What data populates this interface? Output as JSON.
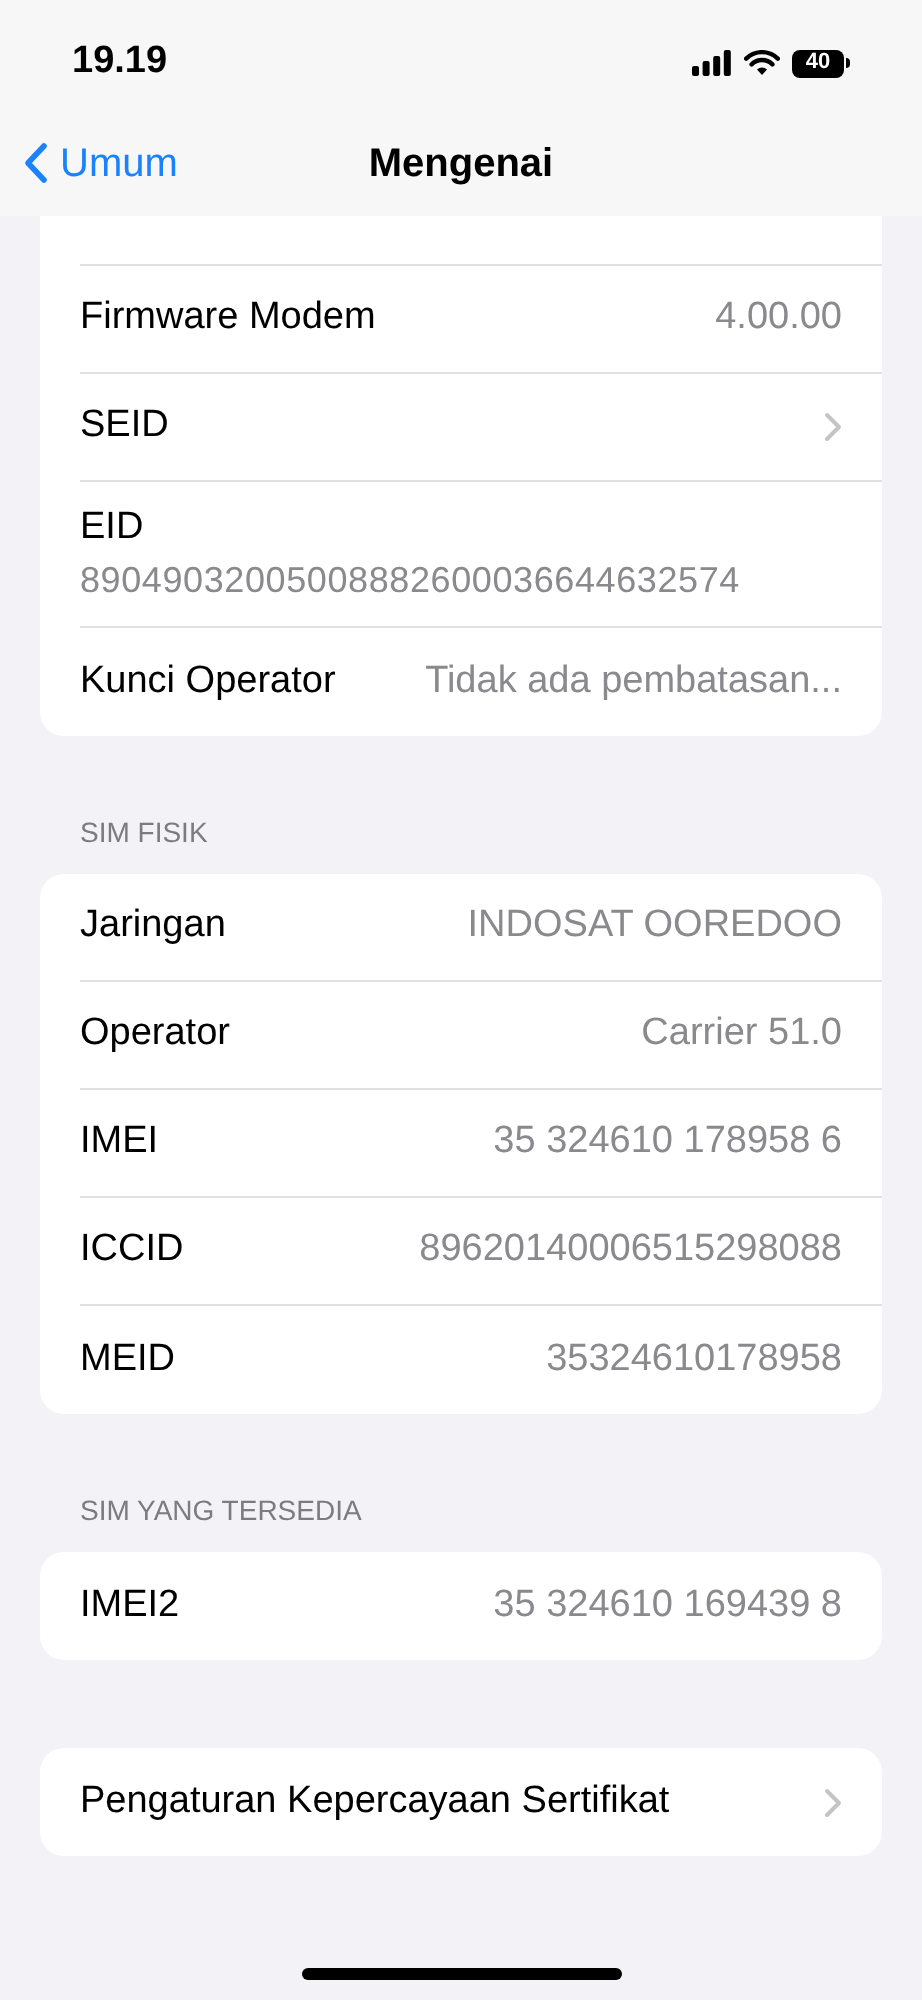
{
  "status_bar": {
    "time": "19.19",
    "battery": "40"
  },
  "nav": {
    "back": "Umum",
    "title": "Mengenai"
  },
  "groups": [
    {
      "rows": [
        {
          "kind": "value",
          "label": "Firmware Modem",
          "value": "4.00.00"
        },
        {
          "kind": "link",
          "label": "SEID"
        },
        {
          "kind": "stacked",
          "label": "EID",
          "value": "89049032005008882600036644632574"
        },
        {
          "kind": "value",
          "label": "Kunci Operator",
          "value": "Tidak ada pembatasan..."
        }
      ]
    },
    {
      "header": "SIM FISIK",
      "rows": [
        {
          "kind": "value",
          "label": "Jaringan",
          "value": "INDOSAT OOREDOO"
        },
        {
          "kind": "value",
          "label": "Operator",
          "value": "Carrier 51.0"
        },
        {
          "kind": "value",
          "label": "IMEI",
          "value": "35 324610 178958 6"
        },
        {
          "kind": "value",
          "label": "ICCID",
          "value": "89620140006515298088"
        },
        {
          "kind": "value",
          "label": "MEID",
          "value": "35324610178958"
        }
      ]
    },
    {
      "header": "SIM YANG TERSEDIA",
      "rows": [
        {
          "kind": "value",
          "label": "IMEI2",
          "value": "35 324610 169439 8"
        }
      ]
    },
    {
      "rows": [
        {
          "kind": "link",
          "label": "Pengaturan Kepercayaan Sertifikat"
        }
      ]
    }
  ]
}
